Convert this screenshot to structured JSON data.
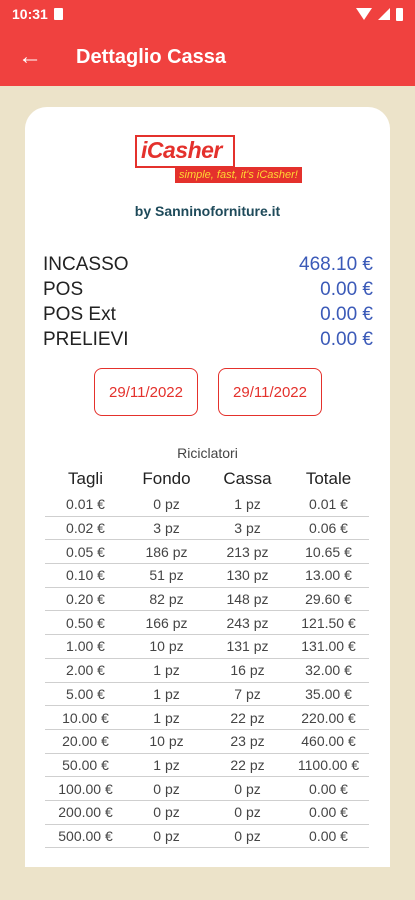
{
  "status_bar": {
    "time": "10:31"
  },
  "app_bar": {
    "title": "Dettaglio Cassa"
  },
  "logo": {
    "name": "iCasher",
    "slogan": "simple, fast, it's iCasher!"
  },
  "byline": "by Sanninoforniture.it",
  "summary": [
    {
      "label": "INCASSO",
      "value": "468.10 €"
    },
    {
      "label": "POS",
      "value": "0.00 €"
    },
    {
      "label": "POS Ext",
      "value": "0.00 €"
    },
    {
      "label": "PRELIEVI",
      "value": "0.00 €"
    }
  ],
  "dates": {
    "from": "29/11/2022",
    "to": "29/11/2022"
  },
  "riciclatori": {
    "title": "Riciclatori",
    "headers": [
      "Tagli",
      "Fondo",
      "Cassa",
      "Totale"
    ],
    "rows": [
      [
        "0.01 €",
        "0 pz",
        "1 pz",
        "0.01 €"
      ],
      [
        "0.02 €",
        "3 pz",
        "3 pz",
        "0.06 €"
      ],
      [
        "0.05 €",
        "186 pz",
        "213 pz",
        "10.65 €"
      ],
      [
        "0.10 €",
        "51 pz",
        "130 pz",
        "13.00 €"
      ],
      [
        "0.20 €",
        "82 pz",
        "148 pz",
        "29.60 €"
      ],
      [
        "0.50 €",
        "166 pz",
        "243 pz",
        "121.50 €"
      ],
      [
        "1.00 €",
        "10 pz",
        "131 pz",
        "131.00 €"
      ],
      [
        "2.00 €",
        "1 pz",
        "16 pz",
        "32.00 €"
      ],
      [
        "5.00 €",
        "1 pz",
        "7 pz",
        "35.00 €"
      ],
      [
        "10.00 €",
        "1 pz",
        "22 pz",
        "220.00 €"
      ],
      [
        "20.00 €",
        "10 pz",
        "23 pz",
        "460.00 €"
      ],
      [
        "50.00 €",
        "1 pz",
        "22 pz",
        "1100.00 €"
      ],
      [
        "100.00 €",
        "0 pz",
        "0 pz",
        "0.00 €"
      ],
      [
        "200.00 €",
        "0 pz",
        "0 pz",
        "0.00 €"
      ],
      [
        "500.00 €",
        "0 pz",
        "0 pz",
        "0.00 €"
      ]
    ]
  },
  "colors": {
    "accent": "#f0413f",
    "background": "#ece3c9",
    "value_blue": "#3b5ab8"
  },
  "icons": {
    "back": "arrow-left-icon"
  }
}
